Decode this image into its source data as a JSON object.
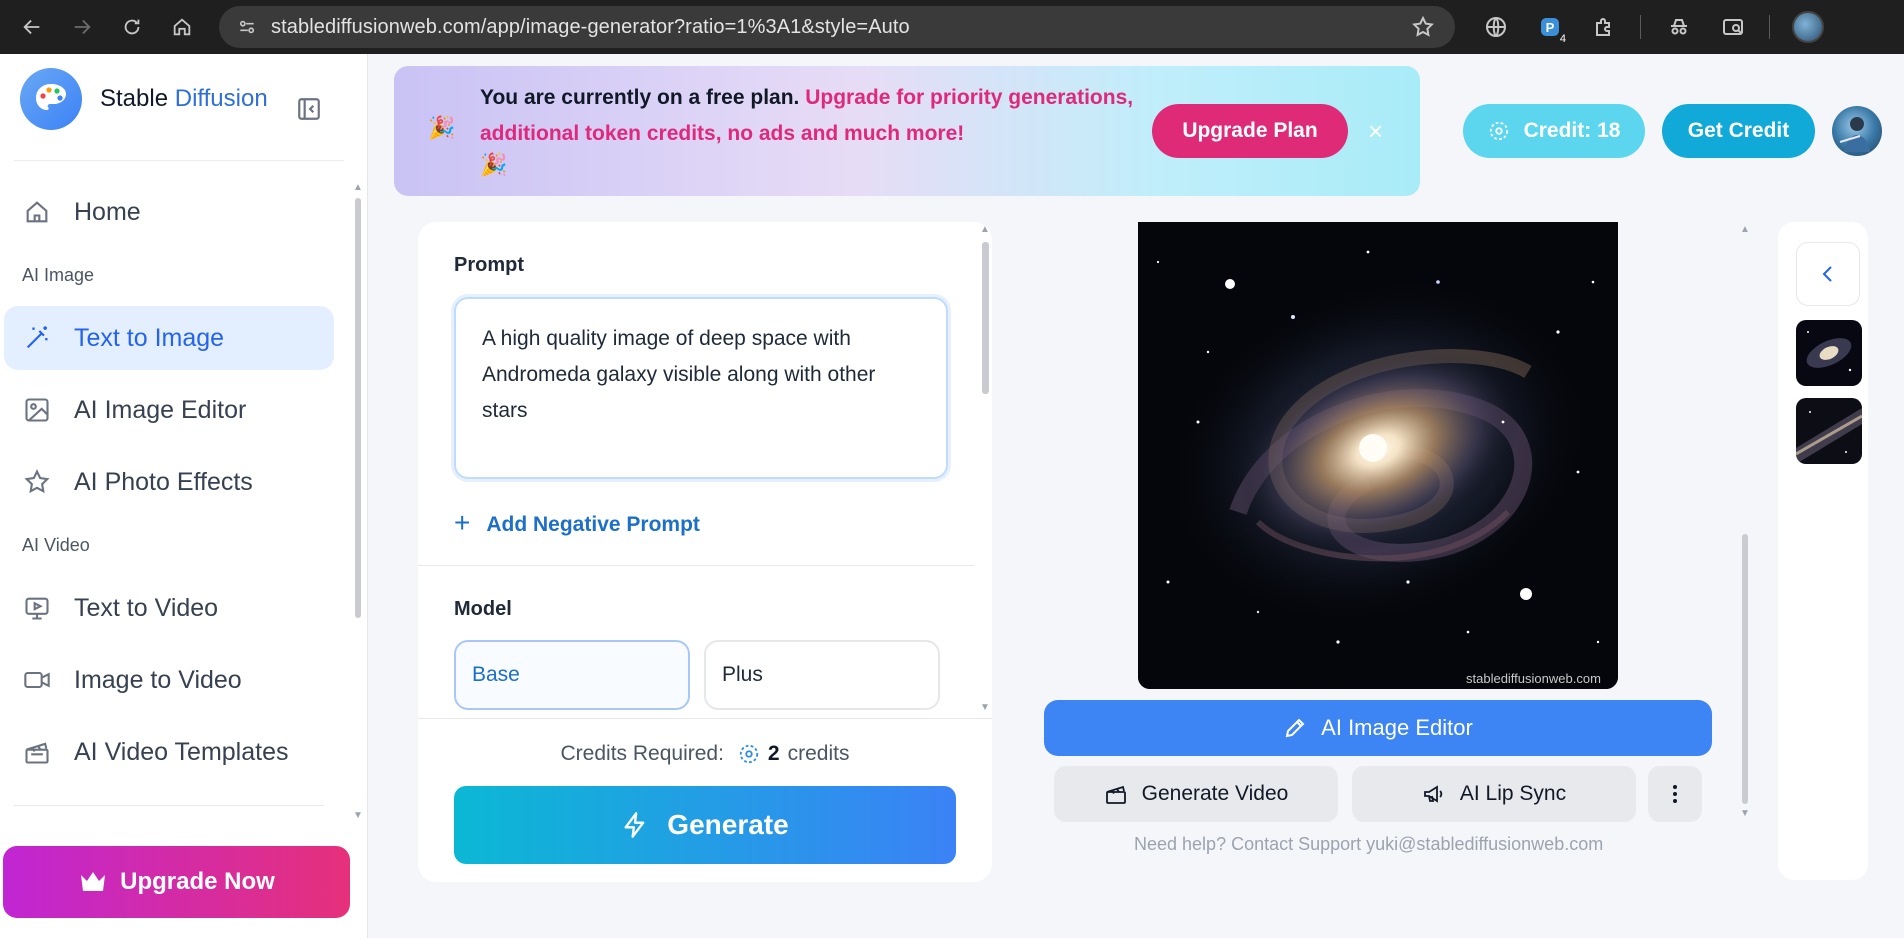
{
  "browser": {
    "url": "stablediffusionweb.com/app/image-generator?ratio=1%3A1&style=Auto",
    "extension_badge": "4"
  },
  "sidebar": {
    "brand_first": "Stable",
    "brand_second": "Diffusion",
    "items": [
      {
        "label": "Home",
        "icon": "home-icon"
      },
      {
        "label": "Text to Image",
        "icon": "magic-wand-icon",
        "active": true
      },
      {
        "label": "AI Image Editor",
        "icon": "image-icon"
      },
      {
        "label": "AI Photo Effects",
        "icon": "star-icon"
      },
      {
        "label": "Text to Video",
        "icon": "video-play-icon"
      },
      {
        "label": "Image to Video",
        "icon": "camera-icon"
      },
      {
        "label": "AI Video Templates",
        "icon": "clapper-icon"
      }
    ],
    "sections": {
      "image": "AI Image",
      "video": "AI Video"
    },
    "upgrade_label": "Upgrade Now"
  },
  "promo": {
    "text_plain": "You are currently on a free plan.",
    "text_highlight": "Upgrade for priority generations, additional token credits, no ads and much more!",
    "upgrade_button": "Upgrade Plan",
    "close": "×"
  },
  "header": {
    "credit_label": "Credit: 18",
    "get_credit_label": "Get Credit"
  },
  "prompt_panel": {
    "prompt_label": "Prompt",
    "prompt_value": "A high quality image of deep space with Andromeda galaxy visible along with other stars",
    "negative_prompt_label": "Add Negative Prompt",
    "model_label": "Model",
    "models": [
      "Base",
      "Plus"
    ],
    "selected_model": "Base",
    "credits_required_label": "Credits Required:",
    "credits_value": "2",
    "credits_unit": "credits",
    "generate_label": "Generate"
  },
  "result": {
    "watermark": "stablediffusionweb.com",
    "editor_button": "AI Image Editor",
    "generate_video_button": "Generate Video",
    "lip_sync_button": "AI Lip Sync",
    "help_text": "Need help? Contact Support yuki@stablediffusionweb.com"
  },
  "colors": {
    "accent": "#3d84f5",
    "pink": "#df2a78",
    "cyan": "#11a9d8"
  }
}
